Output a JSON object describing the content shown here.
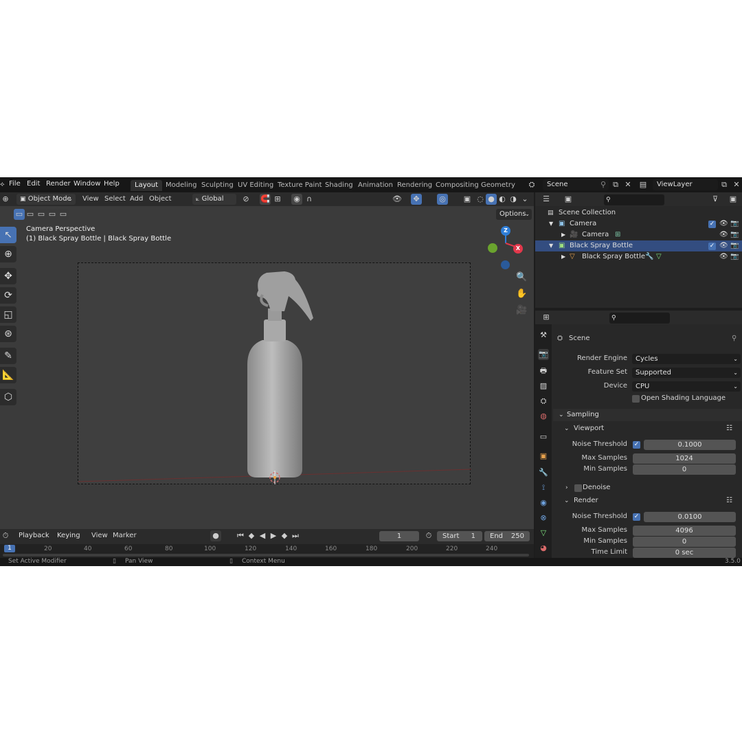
{
  "menu": {
    "file": "File",
    "edit": "Edit",
    "render": "Render",
    "window": "Window",
    "help": "Help"
  },
  "workspaces": [
    "Layout",
    "Modeling",
    "Sculpting",
    "UV Editing",
    "Texture Paint",
    "Shading",
    "Animation",
    "Rendering",
    "Compositing",
    "Geometry Noc"
  ],
  "scene_field": "Scene",
  "viewlayer_field": "ViewLayer",
  "viewport": {
    "mode": "Object Mode",
    "menus": [
      "View",
      "Select",
      "Add",
      "Object"
    ],
    "transform_orientation": "Global",
    "options_label": "Options",
    "overlay_line1": "Camera Perspective",
    "overlay_line2": "(1) Black Spray Bottle | Black Spray Bottle",
    "gizmo": {
      "z": "Z",
      "x": "X"
    }
  },
  "timeline": {
    "menus": [
      "Playback",
      "Keying",
      "View",
      "Marker"
    ],
    "current_frame": "1",
    "start_label": "Start",
    "start_value": "1",
    "end_label": "End",
    "end_value": "250",
    "ticks": [
      "1",
      "20",
      "40",
      "60",
      "80",
      "100",
      "120",
      "140",
      "160",
      "180",
      "200",
      "220",
      "240"
    ]
  },
  "statusbar": {
    "left": "Set Active Modifier",
    "middle": "Pan View",
    "right": "Context Menu",
    "version": "3.5.0"
  },
  "outliner": {
    "root": "Scene Collection",
    "rows": [
      {
        "label": "Camera",
        "kind": "collection"
      },
      {
        "label": "Camera",
        "kind": "object"
      },
      {
        "label": "Black Spray Bottle",
        "kind": "collection"
      },
      {
        "label": "Black Spray Bottle",
        "kind": "object"
      }
    ]
  },
  "properties": {
    "context": "Scene",
    "render_engine_label": "Render Engine",
    "render_engine": "Cycles",
    "feature_set_label": "Feature Set",
    "feature_set": "Supported",
    "device_label": "Device",
    "device": "CPU",
    "osl_label": "Open Shading Language",
    "sampling_label": "Sampling",
    "viewport_label": "Viewport",
    "noise_threshold_label": "Noise Threshold",
    "vp_noise_threshold": "0.1000",
    "max_samples_label": "Max Samples",
    "vp_max_samples": "1024",
    "min_samples_label": "Min Samples",
    "vp_min_samples": "0",
    "denoise_label": "Denoise",
    "render_label": "Render",
    "r_noise_threshold": "0.0100",
    "r_max_samples": "4096",
    "r_min_samples": "0",
    "time_limit_label": "Time Limit",
    "r_time_limit": "0 sec"
  },
  "colors": {
    "accent": "#4772b3",
    "selection": "#334d80",
    "gizmo_x": "#e2384b",
    "gizmo_y": "#6aa32e",
    "gizmo_z": "#2f7ed8"
  }
}
